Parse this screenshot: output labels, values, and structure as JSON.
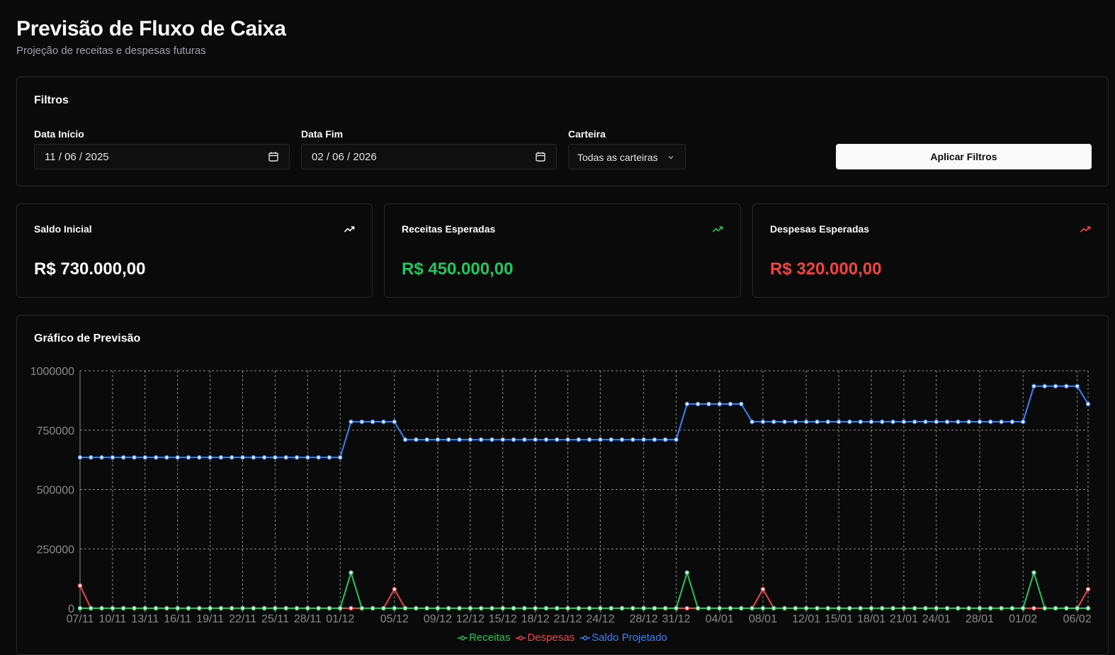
{
  "header": {
    "title": "Previsão de Fluxo de Caixa",
    "subtitle": "Projeção de receitas e despesas futuras"
  },
  "filters": {
    "title": "Filtros",
    "start_label": "Data Início",
    "start_value": "11 / 06 / 2025",
    "end_label": "Data Fim",
    "end_value": "02 / 06 / 2026",
    "wallet_label": "Carteira",
    "wallet_value": "Todas as carteiras",
    "apply_label": "Aplicar Filtros"
  },
  "stats": [
    {
      "label": "Saldo Inicial",
      "value": "R$ 730.000,00",
      "color": "#fafafa",
      "icon": "trending-up-icon"
    },
    {
      "label": "Receitas Esperadas",
      "value": "R$ 450.000,00",
      "color": "#22c55e",
      "icon": "trending-up-icon"
    },
    {
      "label": "Despesas Esperadas",
      "value": "R$ 320.000,00",
      "color": "#ef4444",
      "icon": "trending-up-icon"
    }
  ],
  "colors": {
    "receitas": "#22c55e",
    "despesas": "#ef4444",
    "saldo": "#3b82f6",
    "grid": "#8a8a8a"
  },
  "chart": {
    "title": "Gráfico de Previsão"
  },
  "chart_data": {
    "type": "line",
    "ylim": [
      0,
      1000000
    ],
    "y_ticks": [
      0,
      250000,
      500000,
      750000,
      1000000
    ],
    "y_tick_labels": [
      "0",
      "250000",
      "500000",
      "750000",
      "1000000"
    ],
    "x_tick_labels": [
      "07/11",
      "10/11",
      "13/11",
      "16/11",
      "19/11",
      "22/11",
      "25/11",
      "28/11",
      "01/12",
      "05/12",
      "09/12",
      "12/12",
      "15/12",
      "18/12",
      "21/12",
      "24/12",
      "28/12",
      "31/12",
      "04/01",
      "08/01",
      "12/01",
      "15/01",
      "18/01",
      "21/01",
      "24/01",
      "28/01",
      "01/02",
      "06/02"
    ],
    "x_tick_index": [
      0,
      3,
      6,
      9,
      12,
      15,
      18,
      21,
      24,
      29,
      33,
      36,
      39,
      42,
      45,
      48,
      52,
      55,
      59,
      63,
      67,
      70,
      73,
      76,
      79,
      83,
      87,
      92
    ],
    "grid": true,
    "legend_position": "bottom",
    "series": [
      {
        "name": "Receitas",
        "color": "#22c55e",
        "values": [
          0,
          0,
          0,
          0,
          0,
          0,
          0,
          0,
          0,
          0,
          0,
          0,
          0,
          0,
          0,
          0,
          0,
          0,
          0,
          0,
          0,
          0,
          0,
          0,
          0,
          150000,
          0,
          0,
          0,
          0,
          0,
          0,
          0,
          0,
          0,
          0,
          0,
          0,
          0,
          0,
          0,
          0,
          0,
          0,
          0,
          0,
          0,
          0,
          0,
          0,
          0,
          0,
          0,
          0,
          0,
          0,
          150000,
          0,
          0,
          0,
          0,
          0,
          0,
          0,
          0,
          0,
          0,
          0,
          0,
          0,
          0,
          0,
          0,
          0,
          0,
          0,
          0,
          0,
          0,
          0,
          0,
          0,
          0,
          0,
          0,
          0,
          0,
          0,
          150000,
          0,
          0,
          0,
          0,
          0
        ]
      },
      {
        "name": "Despesas",
        "color": "#ef4444",
        "values": [
          95000,
          0,
          0,
          0,
          0,
          0,
          0,
          0,
          0,
          0,
          0,
          0,
          0,
          0,
          0,
          0,
          0,
          0,
          0,
          0,
          0,
          0,
          0,
          0,
          0,
          0,
          0,
          0,
          0,
          80000,
          0,
          0,
          0,
          0,
          0,
          0,
          0,
          0,
          0,
          0,
          0,
          0,
          0,
          0,
          0,
          0,
          0,
          0,
          0,
          0,
          0,
          0,
          0,
          0,
          0,
          0,
          0,
          0,
          0,
          0,
          0,
          0,
          0,
          80000,
          0,
          0,
          0,
          0,
          0,
          0,
          0,
          0,
          0,
          0,
          0,
          0,
          0,
          0,
          0,
          0,
          0,
          0,
          0,
          0,
          0,
          0,
          0,
          0,
          0,
          0,
          0,
          0,
          0,
          80000
        ]
      },
      {
        "name": "Saldo Projetado",
        "color": "#3b82f6",
        "values": [
          635000,
          635000,
          635000,
          635000,
          635000,
          635000,
          635000,
          635000,
          635000,
          635000,
          635000,
          635000,
          635000,
          635000,
          635000,
          635000,
          635000,
          635000,
          635000,
          635000,
          635000,
          635000,
          635000,
          635000,
          635000,
          785000,
          785000,
          785000,
          785000,
          785000,
          710000,
          710000,
          710000,
          710000,
          710000,
          710000,
          710000,
          710000,
          710000,
          710000,
          710000,
          710000,
          710000,
          710000,
          710000,
          710000,
          710000,
          710000,
          710000,
          710000,
          710000,
          710000,
          710000,
          710000,
          710000,
          710000,
          860000,
          860000,
          860000,
          860000,
          860000,
          860000,
          785000,
          785000,
          785000,
          785000,
          785000,
          785000,
          785000,
          785000,
          785000,
          785000,
          785000,
          785000,
          785000,
          785000,
          785000,
          785000,
          785000,
          785000,
          785000,
          785000,
          785000,
          785000,
          785000,
          785000,
          785000,
          785000,
          935000,
          935000,
          935000,
          935000,
          935000,
          860000
        ]
      }
    ]
  }
}
